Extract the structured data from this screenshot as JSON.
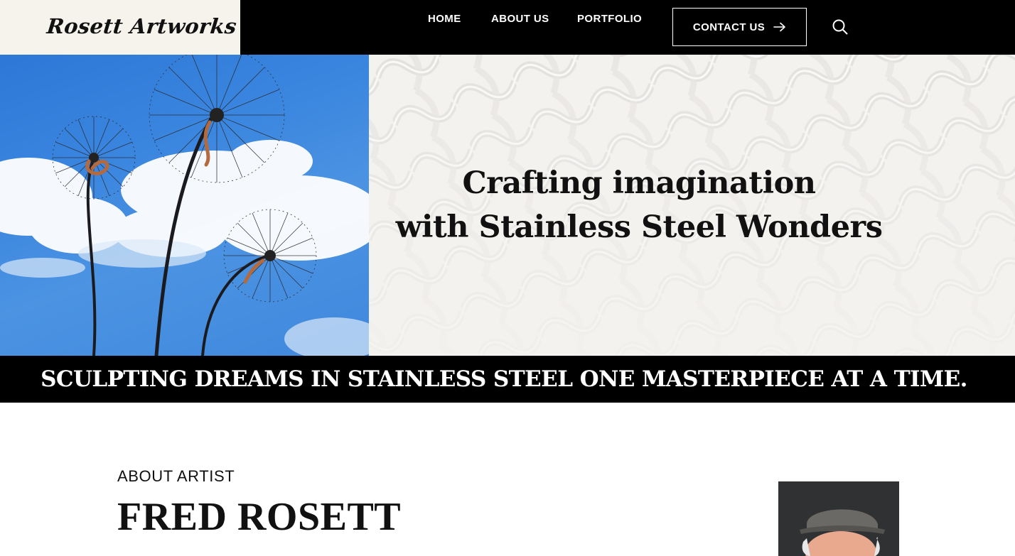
{
  "header": {
    "logo": "Rosett Artworks",
    "nav": {
      "home": "HOME",
      "about": "ABOUT US",
      "portfolio": "PORTFOLIO"
    },
    "contact_label": "CONTACT US"
  },
  "hero": {
    "heading_line1": "Crafting imagination",
    "heading_line2": "with Stainless Steel Wonders"
  },
  "band": {
    "tagline": "SCULPTING DREAMS IN STAINLESS STEEL ONE MASTERPIECE AT A TIME."
  },
  "about": {
    "label": "ABOUT ARTIST",
    "name": "FRED ROSETT"
  },
  "colors": {
    "header_bg": "#000000",
    "logo_bg": "#f6f2ec",
    "sky": "#3b86df",
    "pattern_bg": "#f4f2ef"
  },
  "icons": {
    "search": "search-icon",
    "arrow": "arrow-right-icon"
  }
}
